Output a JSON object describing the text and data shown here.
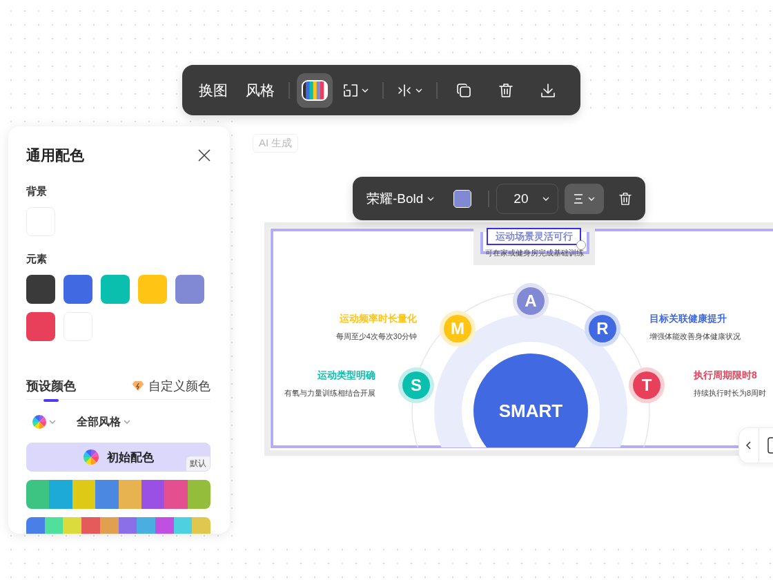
{
  "main_toolbar": {
    "buttons": [
      {
        "kind": "text",
        "label": "换图",
        "selected": false
      },
      {
        "kind": "text",
        "label": "风格",
        "selected": false
      },
      {
        "kind": "palette",
        "selected": true
      },
      {
        "kind": "layout",
        "selected": false
      },
      {
        "kind": "flip",
        "selected": false
      },
      {
        "kind": "copy",
        "selected": false
      },
      {
        "kind": "delete",
        "selected": false
      },
      {
        "kind": "download",
        "selected": false
      }
    ]
  },
  "color_panel": {
    "title": "通用配色",
    "background_label": "背景",
    "background": {
      "color": "#ffffff"
    },
    "elements_label": "元素",
    "element_colors": [
      {
        "color": "#3a3a3a"
      },
      {
        "color": "#4169e1"
      },
      {
        "color": "#0bbfae"
      },
      {
        "color": "#ffc414"
      },
      {
        "color": "#8189d4"
      },
      {
        "color": "#e8405a"
      },
      {
        "color": "#ffffff"
      }
    ],
    "tabs": [
      {
        "label": "预设颜色",
        "kind": "plain",
        "selected": true
      },
      {
        "label": "自定义颜色",
        "kind": "premium",
        "selected": false
      }
    ],
    "style_filter": "全部风格",
    "schemes": [
      {
        "kind": "default",
        "label": "初始配色",
        "badge": "默认",
        "selected": true
      },
      {
        "kind": "strip",
        "selected": false,
        "colors": [
          {
            "color": "#3ec482"
          },
          {
            "color": "#1eaad6"
          },
          {
            "color": "#ddc916"
          },
          {
            "color": "#4a88e2"
          },
          {
            "color": "#e6b350"
          },
          {
            "color": "#9a50e4"
          },
          {
            "color": "#e44f8f"
          },
          {
            "color": "#94bd3c"
          }
        ]
      },
      {
        "kind": "strip",
        "selected": false,
        "colors": [
          {
            "color": "#4a7fe8"
          },
          {
            "color": "#50e09c"
          },
          {
            "color": "#dcdb3e"
          },
          {
            "color": "#e55a5a"
          },
          {
            "color": "#e0a050"
          },
          {
            "color": "#8a6fe8"
          },
          {
            "color": "#4aaee0"
          },
          {
            "color": "#c050e0"
          },
          {
            "color": "#4ed0e0"
          },
          {
            "color": "#e0c850"
          }
        ]
      }
    ]
  },
  "ai_badge": "AI 生成",
  "slide": {
    "center": "SMART",
    "selected_block": {
      "title": "运动场景灵活可行",
      "description": "可在家或健身房完成基础训练"
    },
    "items": [
      {
        "letter": "M",
        "color": "#ffc414",
        "title": "运动频率时长量化",
        "description": "每周至少4次每次30分钟"
      },
      {
        "letter": "A",
        "color": "#8189d4"
      },
      {
        "letter": "R",
        "color": "#4169e1",
        "title": "目标关联健康提升",
        "description": "增强体能改善身体健康状况"
      },
      {
        "letter": "S",
        "color": "#0bbfae",
        "title": "运动类型明确",
        "description": "有氧与力量训练相结合开展"
      },
      {
        "letter": "T",
        "color": "#e8405a",
        "title": "执行周期限时8",
        "description": "持续执行时长为8周时"
      }
    ]
  },
  "text_toolbar": {
    "font": "荣耀-Bold",
    "color": "#8189d4",
    "size": "20",
    "align": {
      "selected": true
    }
  }
}
